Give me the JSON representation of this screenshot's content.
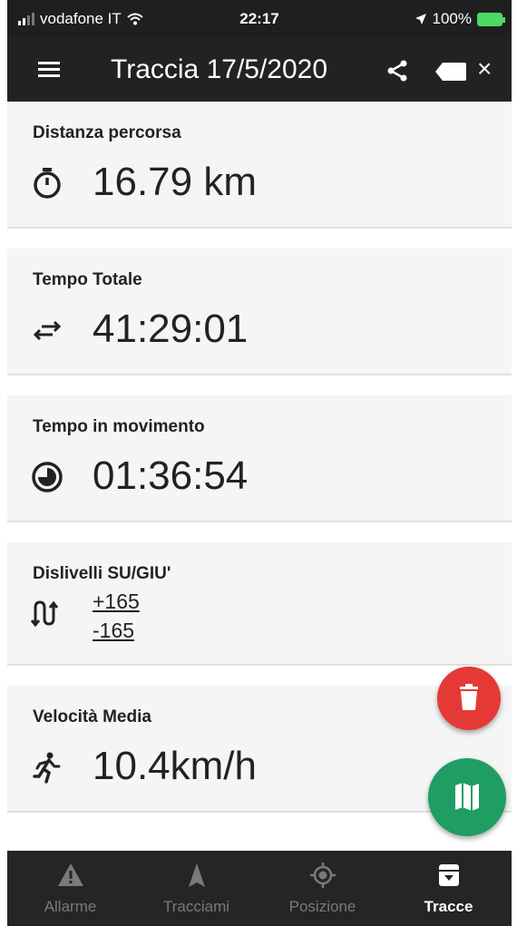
{
  "status_bar": {
    "carrier": "vodafone IT",
    "time": "22:17",
    "battery": "100%"
  },
  "app_bar": {
    "title": "Traccia 17/5/2020"
  },
  "stats": {
    "distance": {
      "label": "Distanza percorsa",
      "value": "16.79 km",
      "icon": "stopwatch-icon"
    },
    "total_time": {
      "label": "Tempo Totale",
      "value": "41:29:01",
      "icon": "swap-arrows-icon"
    },
    "moving_time": {
      "label": "Tempo in movimento",
      "value": "01:36:54",
      "icon": "pie-clock-icon"
    },
    "elevation": {
      "label": "Dislivelli SU/GIU'",
      "up": "+165",
      "down": "-165",
      "icon": "elevation-arrows-icon"
    },
    "avg_speed": {
      "label": "Velocità Media",
      "value": "10.4km/h",
      "icon": "running-person-icon"
    }
  },
  "bottom_nav": {
    "items": [
      {
        "label": "Allarme",
        "icon": "warning-icon",
        "active": false
      },
      {
        "label": "Tracciami",
        "icon": "navigation-arrow-icon",
        "active": false
      },
      {
        "label": "Posizione",
        "icon": "location-target-icon",
        "active": false
      },
      {
        "label": "Tracce",
        "icon": "archive-box-icon",
        "active": true
      }
    ]
  },
  "colors": {
    "app_bar": "#222222",
    "delete_fab": "#e53935",
    "map_fab": "#1e9e63",
    "nav_active": "#ffffff",
    "nav_inactive": "#7a7a7a"
  }
}
